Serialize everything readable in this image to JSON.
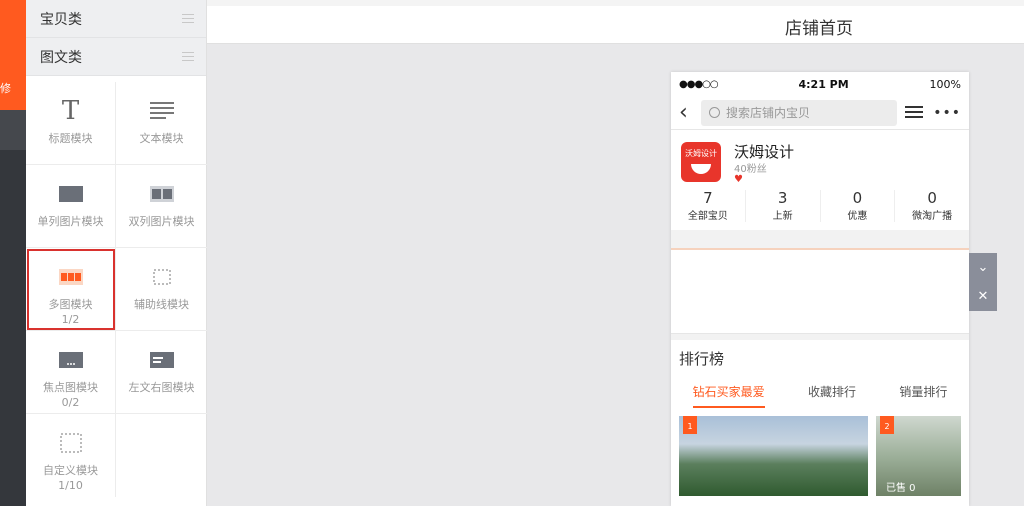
{
  "rail": {
    "active_char": "修"
  },
  "panel": {
    "categories": [
      {
        "label": "宝贝类"
      },
      {
        "label": "图文类"
      }
    ],
    "modules": [
      {
        "label": "标题模块",
        "sub": ""
      },
      {
        "label": "文本模块",
        "sub": ""
      },
      {
        "label": "单列图片模块",
        "sub": ""
      },
      {
        "label": "双列图片模块",
        "sub": ""
      },
      {
        "label": "多图模块",
        "sub": "1/2"
      },
      {
        "label": "辅助线模块",
        "sub": ""
      },
      {
        "label": "焦点图模块",
        "sub": "0/2"
      },
      {
        "label": "左文右图模块",
        "sub": ""
      },
      {
        "label": "自定义模块",
        "sub": "1/10"
      }
    ]
  },
  "header": {
    "title": "店铺首页"
  },
  "phone": {
    "status": {
      "signal": "●●●○○",
      "time": "4:21 PM",
      "battery": "100%"
    },
    "search_placeholder": "搜索店铺内宝贝",
    "shop": {
      "logo_text": "沃姆设计",
      "name": "沃姆设计",
      "fans": "40粉丝",
      "stats": [
        {
          "n": "7",
          "l": "全部宝贝"
        },
        {
          "n": "3",
          "l": "上新"
        },
        {
          "n": "0",
          "l": "优惠"
        },
        {
          "n": "0",
          "l": "微淘广播"
        }
      ]
    },
    "rank": {
      "title": "排行榜",
      "tabs": [
        "钻石买家最爱",
        "收藏排行",
        "销量排行"
      ],
      "items": [
        {
          "badge": "1"
        },
        {
          "badge": "2",
          "sold": "已售 0"
        }
      ]
    }
  },
  "colors": {
    "accent": "#ff5a1f",
    "selected_outline": "#d9322e"
  }
}
